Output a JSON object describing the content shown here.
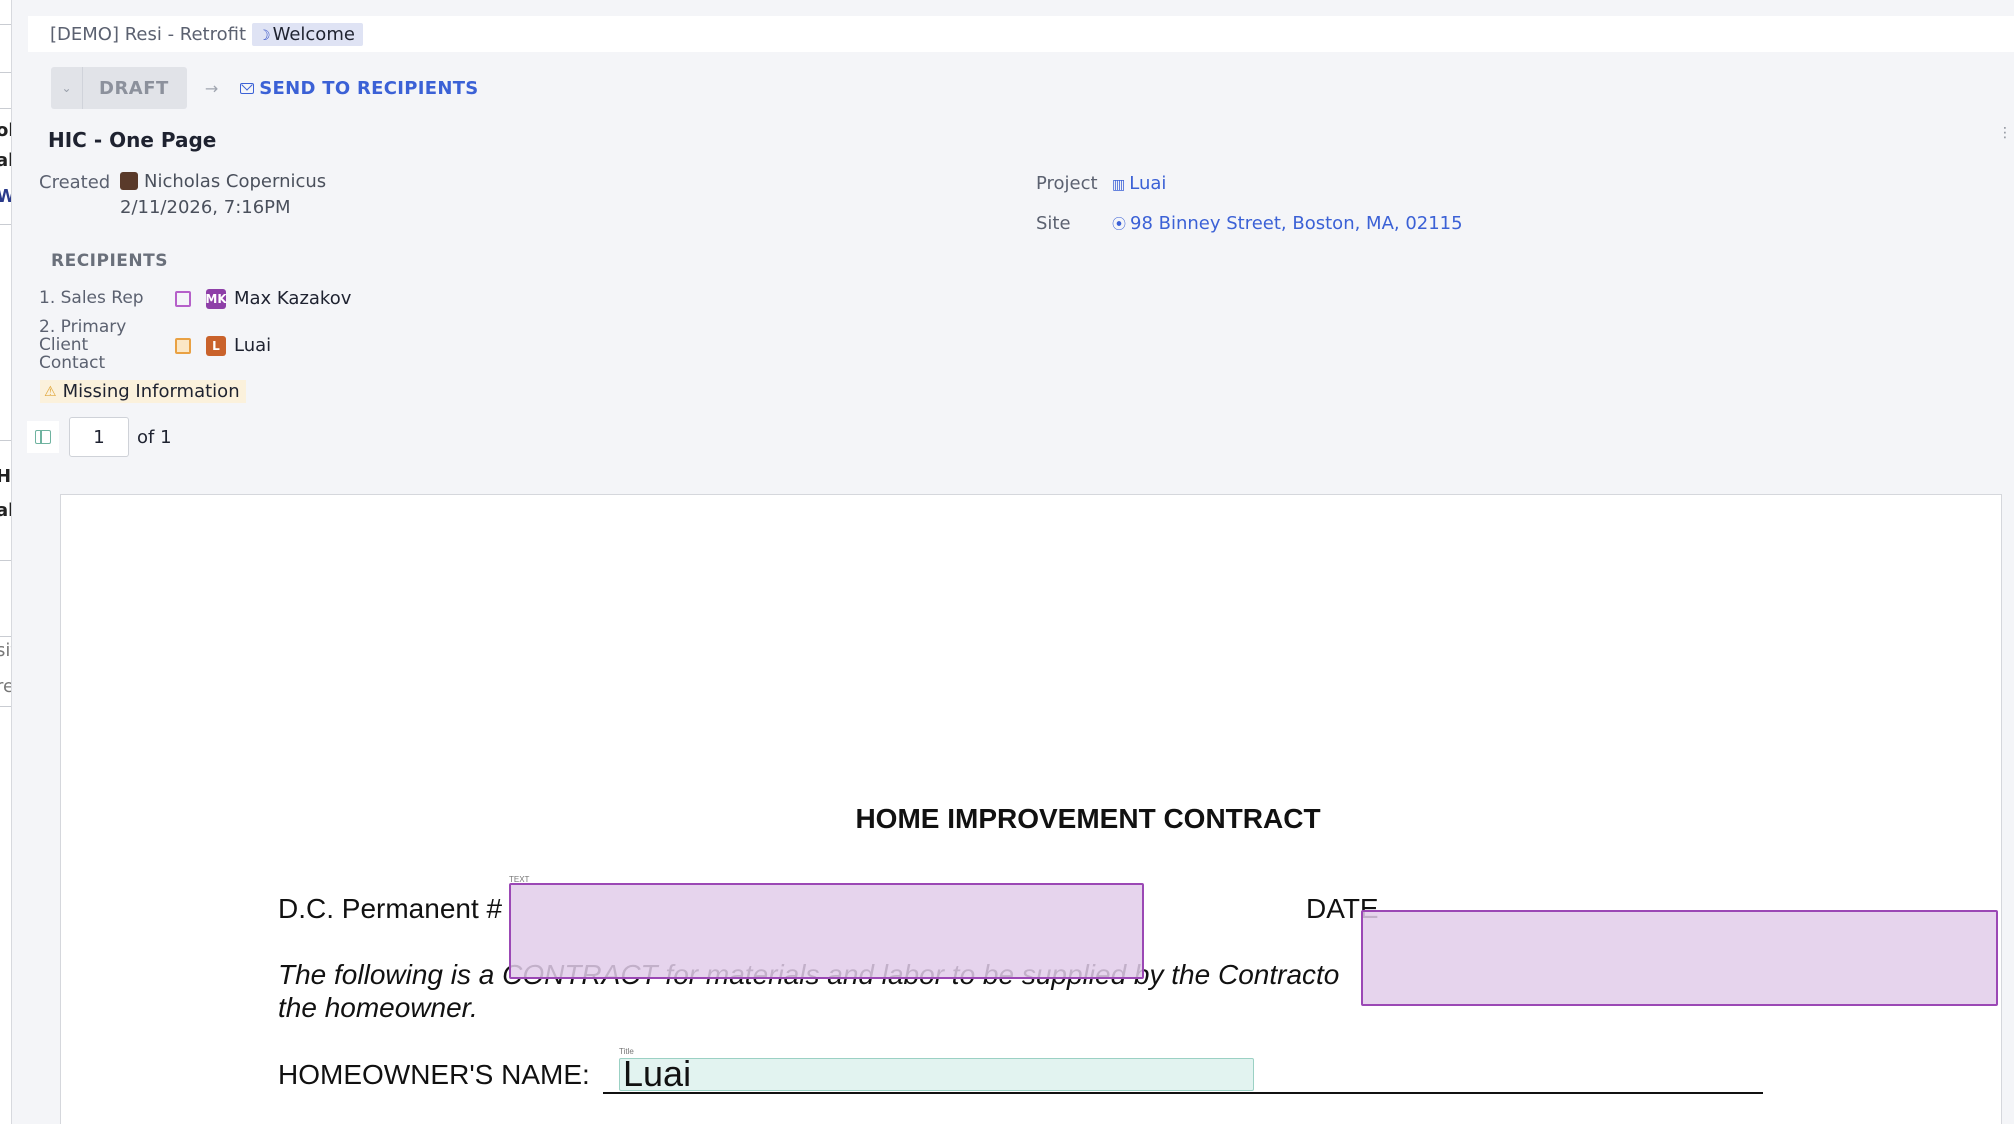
{
  "breadcrumb": {
    "project": "[DEMO] Resi - Retrofit",
    "current": "Welcome"
  },
  "status": {
    "label": "DRAFT",
    "send_label": "SEND TO RECIPIENTS"
  },
  "document": {
    "title": "HIC - One Page"
  },
  "meta": {
    "created_label": "Created",
    "created_by": "Nicholas Copernicus",
    "created_at": "2/11/2026, 7:16PM",
    "project_label": "Project",
    "project_value": "Luai",
    "site_label": "Site",
    "site_value": "98 Binney Street, Boston, MA, 02115"
  },
  "recipients": {
    "heading": "RECIPIENTS",
    "items": [
      {
        "role": "1. Sales Rep",
        "initials": "MK",
        "name": "Max Kazakov",
        "color": "#8e3fa8",
        "box_color": "#b560c9"
      },
      {
        "role": "2. Primary Client Contact",
        "initials": "L",
        "name": "Luai",
        "color": "#c9622b",
        "box_color": "#e9a143"
      }
    ]
  },
  "warning": {
    "text": "Missing Information"
  },
  "pager": {
    "page": "1",
    "total_label": "of 1"
  },
  "contract": {
    "title": "HOME IMPROVEMENT CONTRACT",
    "permit_label": "D.C. Permanent #",
    "date_label": "DATE",
    "intro_line1": "The following is a CONTRACT for materials and labor to be supplied by the Contracto",
    "intro_line2": "the homeowner.",
    "owner_label": "HOMEOWNER'S NAME:",
    "owner_value": "Luai",
    "field_tag_text": "TEXT",
    "field_tag_title": "Title"
  },
  "left_strip": [
    "ol",
    "ak",
    "W",
    "H",
    "al",
    "sit",
    "re"
  ]
}
